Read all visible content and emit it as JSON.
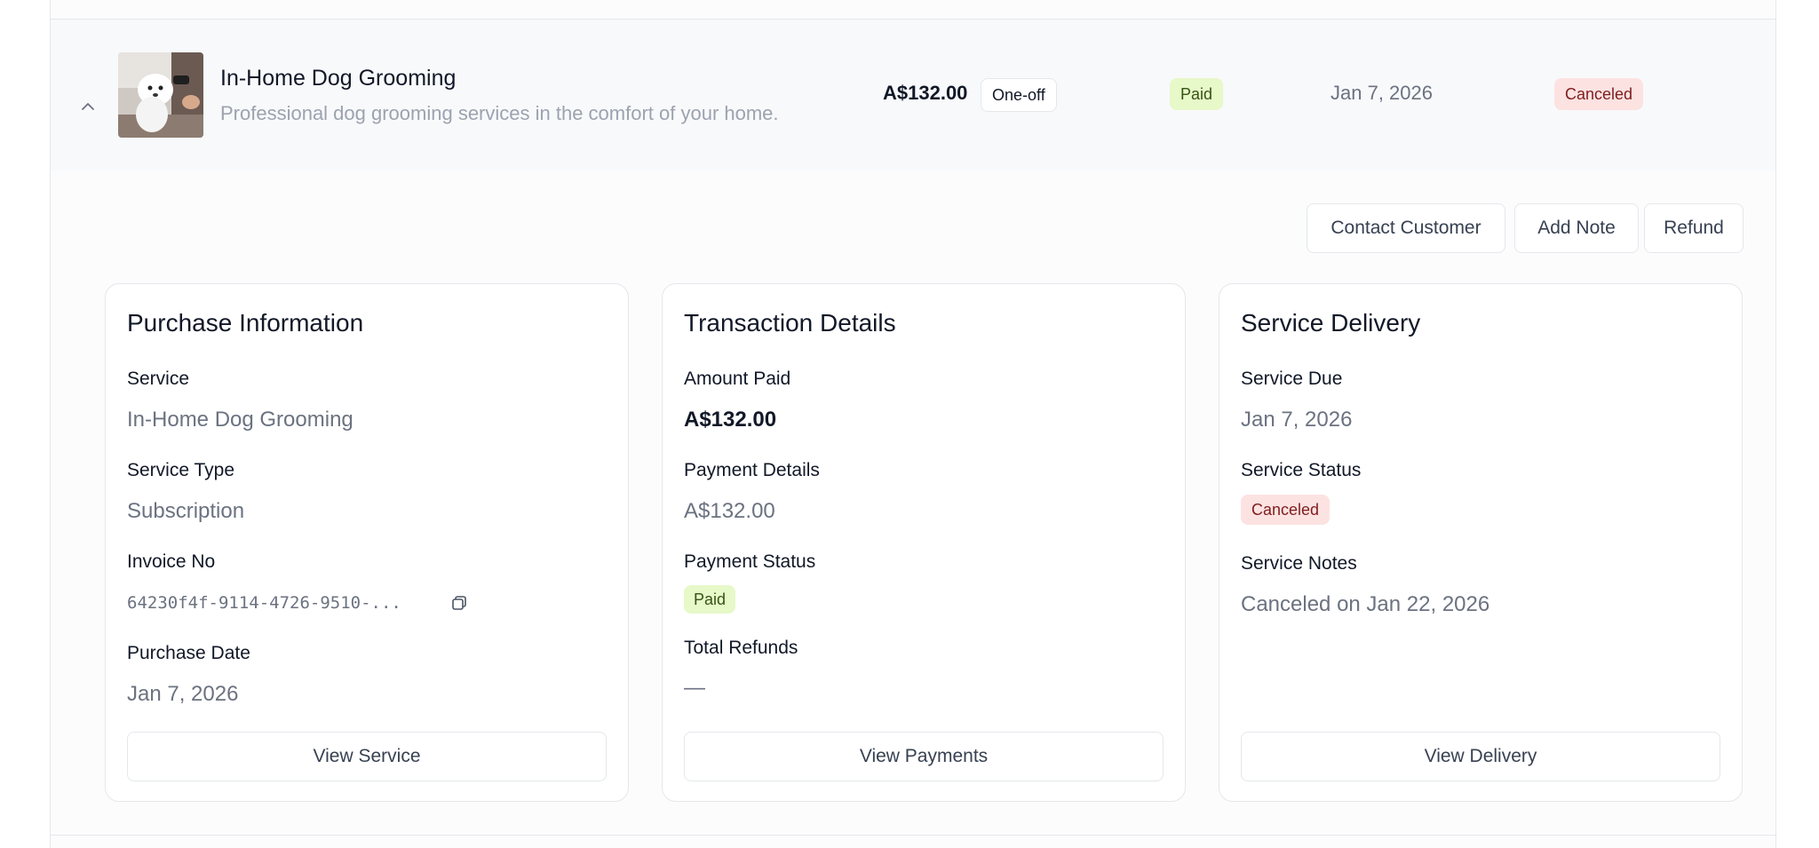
{
  "row": {
    "title": "In-Home Dog Grooming",
    "subtitle": "Professional dog grooming services in the comfort of your home.",
    "price": "A$132.00",
    "type_badge": "One-off",
    "payment_badge": "Paid",
    "date": "Jan 7, 2026",
    "status_badge": "Canceled"
  },
  "actions": {
    "contact": "Contact Customer",
    "add_note": "Add Note",
    "refund": "Refund"
  },
  "purchase": {
    "heading": "Purchase Information",
    "service_label": "Service",
    "service_value": "In-Home Dog Grooming",
    "type_label": "Service Type",
    "type_value": "Subscription",
    "invoice_label": "Invoice No",
    "invoice_value": "64230f4f-9114-4726-9510-...",
    "date_label": "Purchase Date",
    "date_value": "Jan 7, 2026",
    "button": "View Service"
  },
  "transaction": {
    "heading": "Transaction Details",
    "amount_label": "Amount Paid",
    "amount_value": "A$132.00",
    "details_label": "Payment Details",
    "details_value": "A$132.00",
    "status_label": "Payment Status",
    "status_value": "Paid",
    "refunds_label": "Total Refunds",
    "refunds_value": "—",
    "button": "View Payments"
  },
  "delivery": {
    "heading": "Service Delivery",
    "due_label": "Service Due",
    "due_value": "Jan 7, 2026",
    "status_label": "Service Status",
    "status_value": "Canceled",
    "notes_label": "Service Notes",
    "notes_value": "Canceled on Jan 22, 2026",
    "button": "View Delivery"
  },
  "colors": {
    "paid_bg": "#e7f8c9",
    "canceled_bg": "#fde2e2",
    "border": "#e5e7eb"
  },
  "icons": [
    "chevron-up-icon",
    "copy-icon"
  ]
}
